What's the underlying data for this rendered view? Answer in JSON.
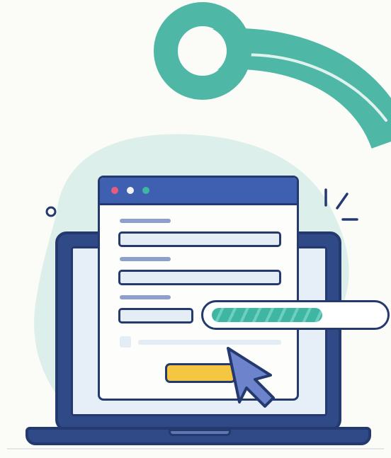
{
  "illustration": {
    "window_dots": [
      {
        "name": "close-dot",
        "color": "#e85d7a"
      },
      {
        "name": "minimize-dot",
        "color": "#f1f1f1"
      },
      {
        "name": "maximize-dot",
        "color": "#3fb5a3"
      }
    ],
    "progress": {
      "fraction": 0.66
    },
    "colors": {
      "accent_teal": "#3fb5a3",
      "outline_navy": "#243a6e",
      "laptop_blue": "#2f4a87",
      "button_yellow": "#f5c642",
      "blob_mint": "#dcefeb"
    },
    "icons": [
      "circle-ring-decoration",
      "sparkle-icon",
      "cursor-arrow-icon",
      "small-circle-icon"
    ]
  }
}
